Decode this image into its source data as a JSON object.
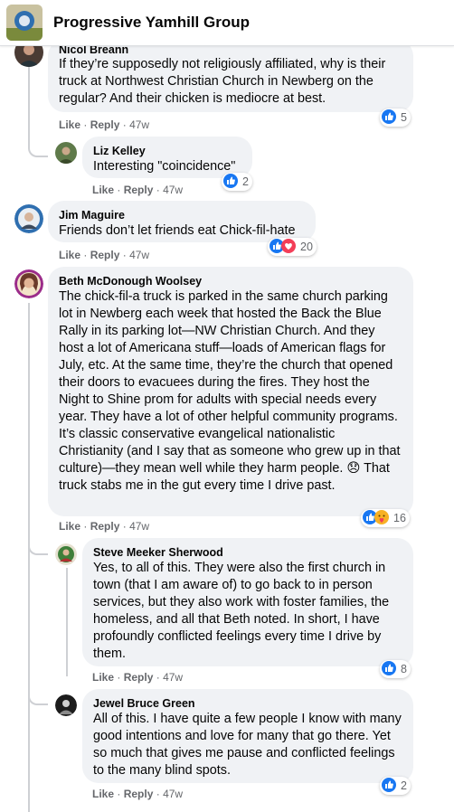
{
  "header": {
    "group_name": "Progressive Yamhill Group"
  },
  "actions": {
    "like": "Like",
    "reply": "Reply",
    "sep": "·"
  },
  "comments": [
    {
      "author": "Nicol Breann",
      "text": "If they’re supposedly not religiously affiliated, why is their truck at Northwest Christian Church in Newberg on the regular? And their chicken is mediocre at best.",
      "time": "47w",
      "reactions": {
        "types": [
          "like"
        ],
        "count": "5"
      }
    },
    {
      "author": "Liz Kelley",
      "text": "Interesting \"coincidence\"",
      "time": "47w",
      "reactions": {
        "types": [
          "like"
        ],
        "count": "2"
      }
    },
    {
      "author": "Jim Maguire",
      "text": "Friends don’t let friends eat Chick-fil-hate",
      "time": "47w",
      "reactions": {
        "types": [
          "like",
          "love"
        ],
        "count": "20"
      }
    },
    {
      "author": "Beth McDonough Woolsey",
      "text": "The chick-fil-a truck is parked in the same church parking lot in Newberg each week that hosted the Back the Blue Rally in its parking lot—NW Christian Church. And they host a lot of Americana stuff—loads of American flags for July, etc. At the same time, they’re the church that opened their doors to evacuees during the fires. They host the Night to Shine prom for adults with special needs every year. They have a lot of other helpful community programs. It’s classic conservative evangelical nationalistic Christianity (and I say that as someone who grew up in that culture)—they mean well while they harm people. 😞 That truck stabs me in the gut every time I drive past.",
      "time": "47w",
      "reactions": {
        "types": [
          "like",
          "care"
        ],
        "count": "16"
      }
    },
    {
      "author": "Steve Meeker Sherwood",
      "text": "Yes, to all of this. They were also the first church in town (that I am aware of) to go back to in person services, but they also work with foster families, the homeless, and all that Beth noted. In short, I have profoundly conflicted feelings every time I drive by them.",
      "time": "47w",
      "reactions": {
        "types": [
          "like"
        ],
        "count": "8"
      }
    },
    {
      "author": "Jewel Bruce Green",
      "text": "All of this. I have quite a few people I know with many good intentions and love for many that go there. Yet so much that gives me pause and conflicted feelings to the many blind spots.",
      "time": "47w",
      "reactions": {
        "types": [
          "like"
        ],
        "count": "2"
      }
    }
  ],
  "colors": {
    "like": "#1877f2",
    "love": "#f33e58",
    "care": "#f7b125",
    "bubble": "#f0f2f5",
    "meta": "#65676b"
  }
}
